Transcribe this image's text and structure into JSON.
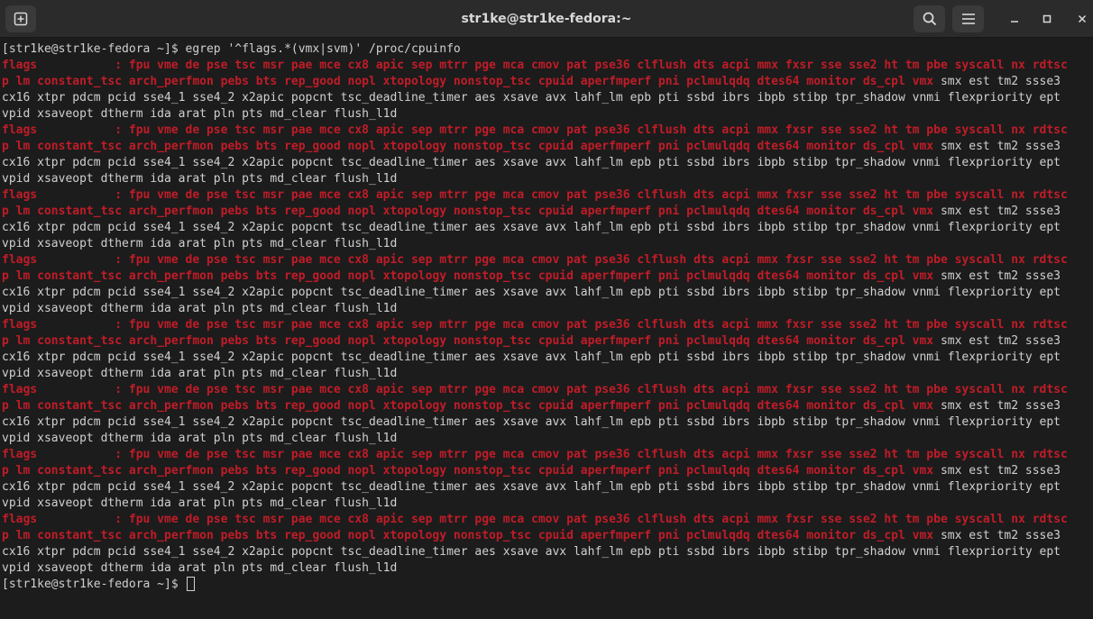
{
  "window": {
    "title": "str1ke@str1ke-fedora:~"
  },
  "colors": {
    "background": "#1c1c1c",
    "titlebar": "#2b2b2b",
    "text": "#d0d0d0",
    "match": "#c01c28"
  },
  "icons": {
    "new_tab": "new-tab-icon",
    "search": "search-icon",
    "menu": "hamburger-menu-icon",
    "minimize": "minimize-icon",
    "maximize": "maximize-icon",
    "close": "close-icon"
  },
  "terminal": {
    "command_line": "[str1ke@str1ke-fedora ~]$ egrep '^flags.*(vmx|svm)' /proc/cpuinfo",
    "prompt": "[str1ke@str1ke-fedora ~]$ ",
    "blocks": [
      {
        "line1": "flags           : fpu vme de pse tsc msr pae mce cx8 apic sep mtrr pge mca cmov pat pse36 clflush dts acpi mmx fxsr sse sse2 ht tm pbe syscall nx rdtsc",
        "line2_match": "p lm constant_tsc arch_perfmon pebs bts rep_good nopl xtopology nonstop_tsc cpuid aperfmperf pni pclmulqdq dtes64 monitor ds_cpl vmx",
        "line2_rest": " smx est tm2 ssse3",
        "line3": "cx16 xtpr pdcm pcid sse4_1 sse4_2 x2apic popcnt tsc_deadline_timer aes xsave avx lahf_lm epb pti ssbd ibrs ibpb stibp tpr_shadow vnmi flexpriority ept",
        "line4": "vpid xsaveopt dtherm ida arat pln pts md_clear flush_l1d"
      },
      {
        "line1": "flags           : fpu vme de pse tsc msr pae mce cx8 apic sep mtrr pge mca cmov pat pse36 clflush dts acpi mmx fxsr sse sse2 ht tm pbe syscall nx rdtsc",
        "line2_match": "p lm constant_tsc arch_perfmon pebs bts rep_good nopl xtopology nonstop_tsc cpuid aperfmperf pni pclmulqdq dtes64 monitor ds_cpl vmx",
        "line2_rest": " smx est tm2 ssse3",
        "line3": "cx16 xtpr pdcm pcid sse4_1 sse4_2 x2apic popcnt tsc_deadline_timer aes xsave avx lahf_lm epb pti ssbd ibrs ibpb stibp tpr_shadow vnmi flexpriority ept",
        "line4": "vpid xsaveopt dtherm ida arat pln pts md_clear flush_l1d"
      },
      {
        "line1": "flags           : fpu vme de pse tsc msr pae mce cx8 apic sep mtrr pge mca cmov pat pse36 clflush dts acpi mmx fxsr sse sse2 ht tm pbe syscall nx rdtsc",
        "line2_match": "p lm constant_tsc arch_perfmon pebs bts rep_good nopl xtopology nonstop_tsc cpuid aperfmperf pni pclmulqdq dtes64 monitor ds_cpl vmx",
        "line2_rest": " smx est tm2 ssse3",
        "line3": "cx16 xtpr pdcm pcid sse4_1 sse4_2 x2apic popcnt tsc_deadline_timer aes xsave avx lahf_lm epb pti ssbd ibrs ibpb stibp tpr_shadow vnmi flexpriority ept",
        "line4": "vpid xsaveopt dtherm ida arat pln pts md_clear flush_l1d"
      },
      {
        "line1": "flags           : fpu vme de pse tsc msr pae mce cx8 apic sep mtrr pge mca cmov pat pse36 clflush dts acpi mmx fxsr sse sse2 ht tm pbe syscall nx rdtsc",
        "line2_match": "p lm constant_tsc arch_perfmon pebs bts rep_good nopl xtopology nonstop_tsc cpuid aperfmperf pni pclmulqdq dtes64 monitor ds_cpl vmx",
        "line2_rest": " smx est tm2 ssse3",
        "line3": "cx16 xtpr pdcm pcid sse4_1 sse4_2 x2apic popcnt tsc_deadline_timer aes xsave avx lahf_lm epb pti ssbd ibrs ibpb stibp tpr_shadow vnmi flexpriority ept",
        "line4": "vpid xsaveopt dtherm ida arat pln pts md_clear flush_l1d"
      },
      {
        "line1": "flags           : fpu vme de pse tsc msr pae mce cx8 apic sep mtrr pge mca cmov pat pse36 clflush dts acpi mmx fxsr sse sse2 ht tm pbe syscall nx rdtsc",
        "line2_match": "p lm constant_tsc arch_perfmon pebs bts rep_good nopl xtopology nonstop_tsc cpuid aperfmperf pni pclmulqdq dtes64 monitor ds_cpl vmx",
        "line2_rest": " smx est tm2 ssse3",
        "line3": "cx16 xtpr pdcm pcid sse4_1 sse4_2 x2apic popcnt tsc_deadline_timer aes xsave avx lahf_lm epb pti ssbd ibrs ibpb stibp tpr_shadow vnmi flexpriority ept",
        "line4": "vpid xsaveopt dtherm ida arat pln pts md_clear flush_l1d"
      },
      {
        "line1": "flags           : fpu vme de pse tsc msr pae mce cx8 apic sep mtrr pge mca cmov pat pse36 clflush dts acpi mmx fxsr sse sse2 ht tm pbe syscall nx rdtsc",
        "line2_match": "p lm constant_tsc arch_perfmon pebs bts rep_good nopl xtopology nonstop_tsc cpuid aperfmperf pni pclmulqdq dtes64 monitor ds_cpl vmx",
        "line2_rest": " smx est tm2 ssse3",
        "line3": "cx16 xtpr pdcm pcid sse4_1 sse4_2 x2apic popcnt tsc_deadline_timer aes xsave avx lahf_lm epb pti ssbd ibrs ibpb stibp tpr_shadow vnmi flexpriority ept",
        "line4": "vpid xsaveopt dtherm ida arat pln pts md_clear flush_l1d"
      },
      {
        "line1": "flags           : fpu vme de pse tsc msr pae mce cx8 apic sep mtrr pge mca cmov pat pse36 clflush dts acpi mmx fxsr sse sse2 ht tm pbe syscall nx rdtsc",
        "line2_match": "p lm constant_tsc arch_perfmon pebs bts rep_good nopl xtopology nonstop_tsc cpuid aperfmperf pni pclmulqdq dtes64 monitor ds_cpl vmx",
        "line2_rest": " smx est tm2 ssse3",
        "line3": "cx16 xtpr pdcm pcid sse4_1 sse4_2 x2apic popcnt tsc_deadline_timer aes xsave avx lahf_lm epb pti ssbd ibrs ibpb stibp tpr_shadow vnmi flexpriority ept",
        "line4": "vpid xsaveopt dtherm ida arat pln pts md_clear flush_l1d"
      },
      {
        "line1": "flags           : fpu vme de pse tsc msr pae mce cx8 apic sep mtrr pge mca cmov pat pse36 clflush dts acpi mmx fxsr sse sse2 ht tm pbe syscall nx rdtsc",
        "line2_match": "p lm constant_tsc arch_perfmon pebs bts rep_good nopl xtopology nonstop_tsc cpuid aperfmperf pni pclmulqdq dtes64 monitor ds_cpl vmx",
        "line2_rest": " smx est tm2 ssse3",
        "line3": "cx16 xtpr pdcm pcid sse4_1 sse4_2 x2apic popcnt tsc_deadline_timer aes xsave avx lahf_lm epb pti ssbd ibrs ibpb stibp tpr_shadow vnmi flexpriority ept",
        "line4": "vpid xsaveopt dtherm ida arat pln pts md_clear flush_l1d"
      }
    ]
  }
}
